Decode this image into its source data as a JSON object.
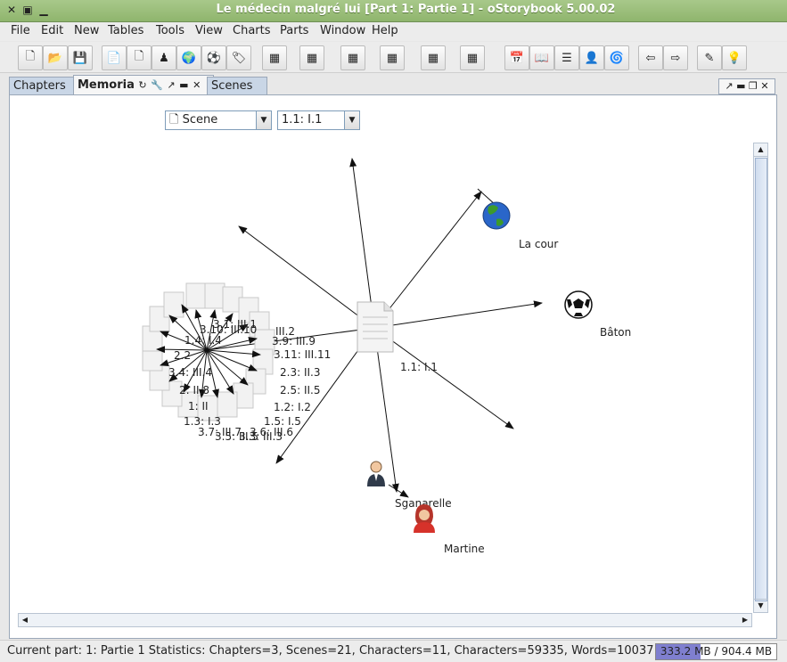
{
  "window": {
    "title": "Le médecin malgré lui [Part 1: Partie 1] - oStorybook 5.00.02"
  },
  "menu": [
    "File",
    "Edit",
    "New",
    "Tables",
    "Tools",
    "View",
    "Charts",
    "Parts",
    "Window",
    "Help"
  ],
  "tabs": {
    "chapters": "Chapters",
    "memoria": "Memoria",
    "scenes": "Scenes"
  },
  "controls": {
    "type_combo": "Scene",
    "scene_combo": "1.1: I.1"
  },
  "graph": {
    "center_label": "1.1: I.1",
    "entities": {
      "location": "La cour",
      "item": "Bâton",
      "char1": "Sganarelle",
      "char2": "Martine"
    },
    "scene_labels": [
      "3.1: III.1",
      "III.2",
      "3.10: III.10",
      "3.9: III.9",
      "1.4: I.4",
      "3.11: III.11",
      "2.2",
      "2.3: II.3",
      "3.4: III.4",
      "2.5: II.5",
      "2: II.8",
      "1.2: I.2",
      "1: II",
      "1.5: I.5",
      "1.3: I.3",
      "3.7: III.7",
      "3.6: III.6",
      "3.5: III.5",
      "3.3: III.3"
    ]
  },
  "status": {
    "text": "Current part: 1: Partie 1  Statistics: Chapters=3,  Scenes=21,  Characters=11,  Characters=59335,  Words=10037",
    "memory": "333.2 MB / 904.4 MB",
    "memory_fraction": 0.368
  },
  "colors": {
    "accent": "#8fb56d",
    "tab_inactive": "#c9d6e6"
  }
}
